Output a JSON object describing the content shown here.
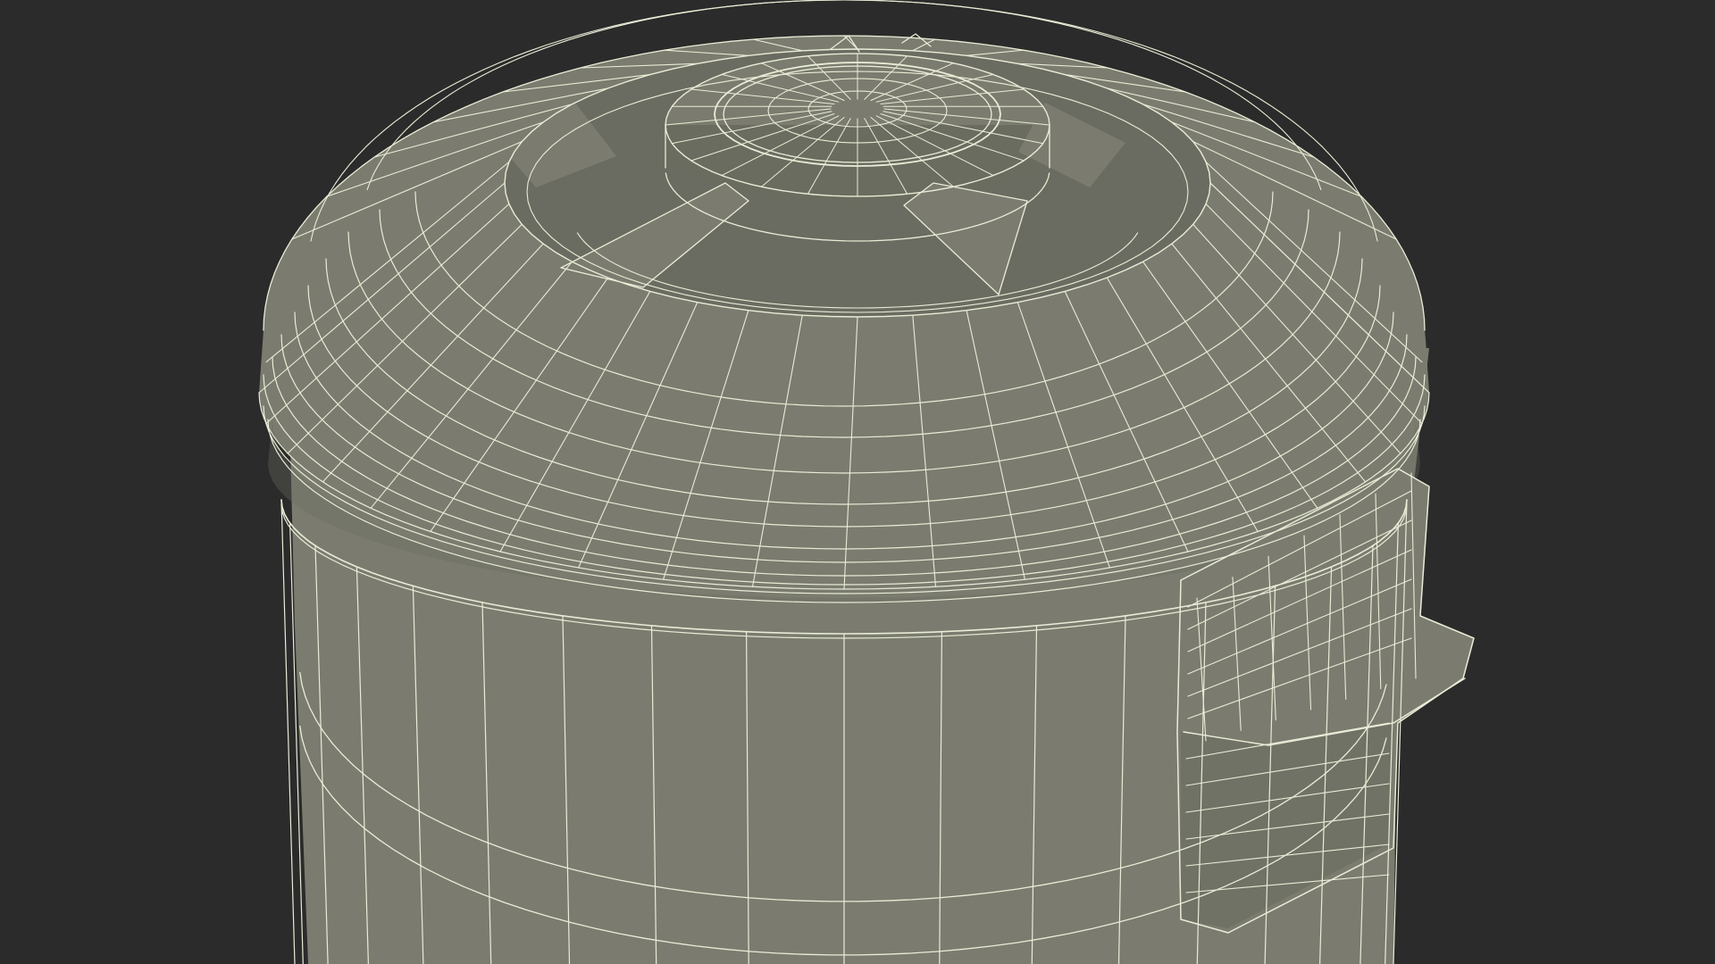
{
  "scene": {
    "background": "#2b2b2b",
    "surface": "#7b7c6f",
    "surface_shadow": "#6b6c60",
    "surface_dark": "#5e5f55",
    "wire": "#e9ecd6"
  }
}
